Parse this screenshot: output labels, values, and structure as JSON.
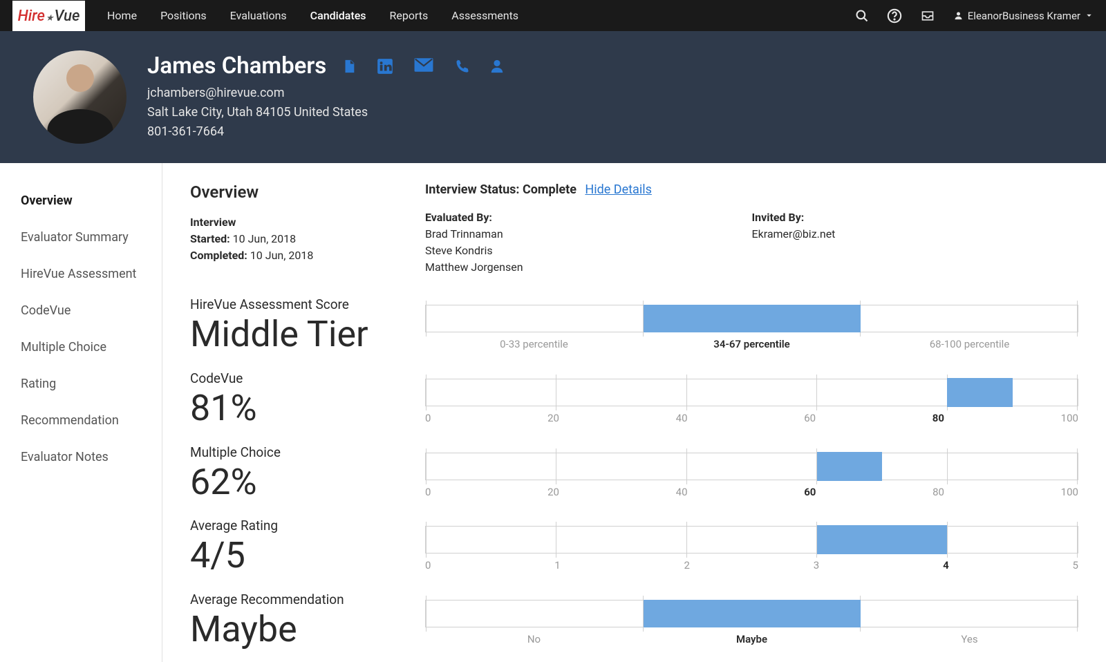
{
  "nav": {
    "items": [
      "Home",
      "Positions",
      "Evaluations",
      "Candidates",
      "Reports",
      "Assessments"
    ]
  },
  "user": {
    "name": "EleanorBusiness Kramer"
  },
  "candidate": {
    "name": "James Chambers",
    "email": "jchambers@hirevue.com",
    "location": "Salt Lake City, Utah 84105 United States",
    "phone": "801-361-7664"
  },
  "sidebar": {
    "items": [
      "Overview",
      "Evaluator Summary",
      "HireVue Assessment",
      "CodeVue",
      "Multiple Choice",
      "Rating",
      "Recommendation",
      "Evaluator Notes"
    ],
    "active": 0
  },
  "overview": {
    "title": "Overview",
    "interview_status_label": "Interview Status:",
    "interview_status_value": "Complete",
    "hide_details": "Hide Details",
    "interview_heading": "Interview",
    "started_label": "Started:",
    "started_value": "10 Jun, 2018",
    "completed_label": "Completed:",
    "completed_value": "10 Jun, 2018",
    "evaluated_by_label": "Evaluated By:",
    "evaluators": [
      "Brad Trinnaman",
      "Steve Kondris",
      "Matthew Jorgensen"
    ],
    "invited_by_label": "Invited By:",
    "invited_by": "Ekramer@biz.net"
  },
  "scores": {
    "hirevue": {
      "label": "HireVue Assessment Score",
      "value": "Middle Tier",
      "segments": [
        "0-33 percentile",
        "34-67 percentile",
        "68-100 percentile"
      ],
      "highlight_index": 1
    },
    "codevue": {
      "label": "CodeVue",
      "value": "81%",
      "ticks": [
        "0",
        "20",
        "40",
        "60",
        "80",
        "100"
      ],
      "highlight_pos": 80,
      "highlight_width": 10,
      "highlight_tick": "80"
    },
    "mc": {
      "label": "Multiple Choice",
      "value": "62%",
      "ticks": [
        "0",
        "20",
        "40",
        "60",
        "80",
        "100"
      ],
      "highlight_pos": 60,
      "highlight_width": 10,
      "highlight_tick": "60"
    },
    "rating": {
      "label": "Average Rating",
      "value": "4/5",
      "ticks": [
        "0",
        "1",
        "2",
        "3",
        "4",
        "5"
      ],
      "highlight_pos": 60,
      "highlight_width": 20,
      "highlight_tick": "4"
    },
    "rec": {
      "label": "Average Recommendation",
      "value": "Maybe",
      "segments": [
        "No",
        "Maybe",
        "Yes"
      ],
      "highlight_index": 1
    }
  },
  "chart_data": [
    {
      "type": "bar",
      "name": "HireVue Assessment Score",
      "categories": [
        "0-33 percentile",
        "34-67 percentile",
        "68-100 percentile"
      ],
      "value": "Middle Tier",
      "highlighted_category": "34-67 percentile"
    },
    {
      "type": "bar",
      "name": "CodeVue",
      "xlim": [
        0,
        100
      ],
      "value": 81,
      "highlight_range": [
        80,
        90
      ]
    },
    {
      "type": "bar",
      "name": "Multiple Choice",
      "xlim": [
        0,
        100
      ],
      "value": 62,
      "highlight_range": [
        60,
        70
      ]
    },
    {
      "type": "bar",
      "name": "Average Rating",
      "xlim": [
        0,
        5
      ],
      "value": 4,
      "highlight_range": [
        3,
        4
      ]
    },
    {
      "type": "bar",
      "name": "Average Recommendation",
      "categories": [
        "No",
        "Maybe",
        "Yes"
      ],
      "value": "Maybe",
      "highlighted_category": "Maybe"
    }
  ]
}
